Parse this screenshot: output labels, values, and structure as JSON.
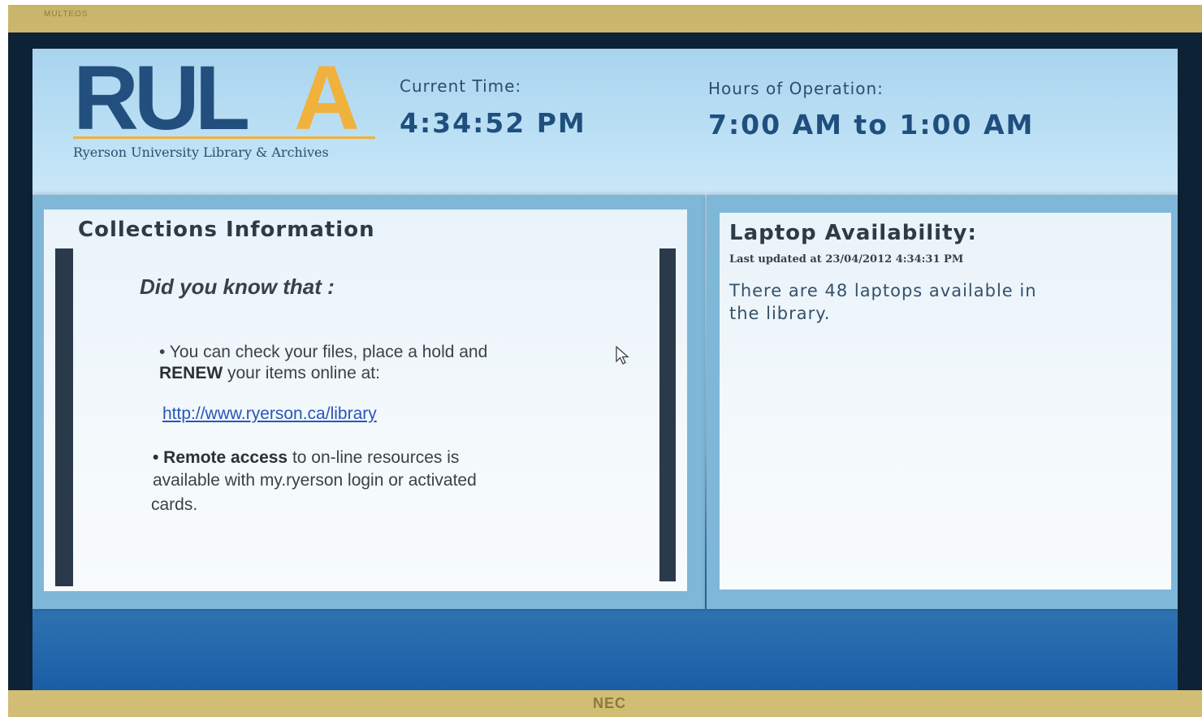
{
  "bezel": {
    "brand_top": "MULTEOS",
    "brand_bottom": "NEC"
  },
  "header": {
    "logo": {
      "wordmark_main": "RUL",
      "wordmark_accent": "A",
      "subtitle": "Ryerson University Library & Archives"
    },
    "current_time": {
      "label": "Current Time:",
      "value": "4:34:52 PM"
    },
    "hours": {
      "label": "Hours of Operation:",
      "value": "7:00 AM to 1:00 AM"
    }
  },
  "collections": {
    "title": "Collections Information",
    "heading": "Did you know that :",
    "bullet1_line1": "•  You can check your files, place a hold and",
    "bullet1_renew": "RENEW",
    "bullet1_line2_rest": " your items online at:",
    "link": "http://www.ryerson.ca/library",
    "bullet2_bold": "• Remote access",
    "bullet2_line1_rest": " to on-line resources is",
    "bullet2_line2": "available with my.ryerson login or activated",
    "bullet2_line3": "cards."
  },
  "laptops": {
    "title": "Laptop Availability:",
    "updated": "Last updated at 23/04/2012 4:34:31 PM",
    "message_line1": "There are 48 laptops available in",
    "message_line2": "the library."
  },
  "colors": {
    "brand_blue": "#234f7e",
    "brand_gold": "#f0b23c",
    "link_blue": "#2a56b8"
  },
  "icons": {
    "cursor": "mouse-pointer-icon"
  }
}
